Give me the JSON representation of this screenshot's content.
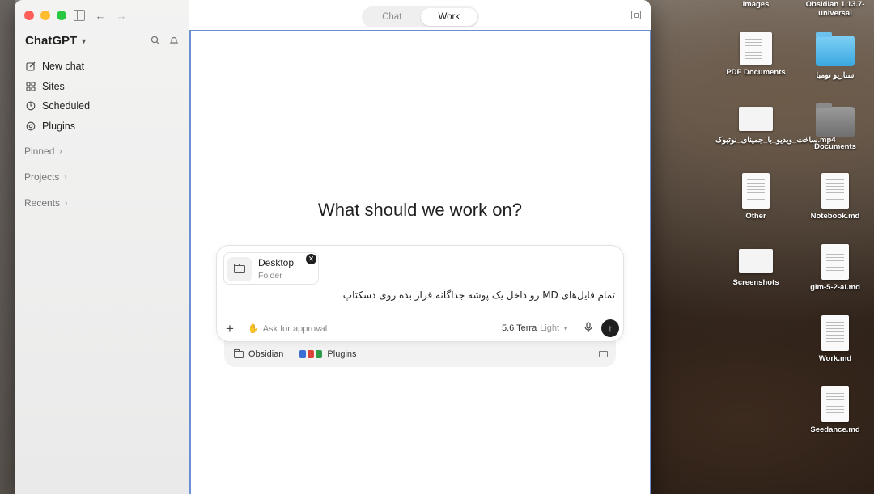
{
  "window": {
    "app_title": "ChatGPT",
    "nav": [
      {
        "label": "New chat",
        "icon": "compose-icon"
      },
      {
        "label": "Sites",
        "icon": "sites-icon"
      },
      {
        "label": "Scheduled",
        "icon": "clock-icon"
      },
      {
        "label": "Plugins",
        "icon": "plugin-icon"
      }
    ],
    "sections": [
      {
        "label": "Pinned"
      },
      {
        "label": "Projects"
      },
      {
        "label": "Recents"
      }
    ]
  },
  "main": {
    "tabs": [
      {
        "label": "Chat",
        "active": false
      },
      {
        "label": "Work",
        "active": true
      }
    ],
    "heading": "What should we work on?",
    "attachment": {
      "name": "Desktop",
      "type": "Folder"
    },
    "prompt": "تمام فایل‌های MD رو داخل یک پوشه جداگانه قرار بده روی دسکتاپ",
    "approval_label": "Ask for approval",
    "model_name": "5.6 Terra",
    "model_mode": "Light",
    "tray": {
      "folder_label": "Obsidian",
      "plugins_label": "Plugins"
    }
  },
  "desktop": {
    "items": [
      {
        "label": "Images"
      },
      {
        "label": "Obsidian 1.13.7-universal"
      },
      {
        "label": "PDF Documents"
      },
      {
        "label": "سناریو تومبا"
      },
      {
        "label": "ساخت_ویدیو_با_جمینای_نوتبوک.mp4"
      },
      {
        "label": "Documents"
      },
      {
        "label": "Other"
      },
      {
        "label": "Notebook.md"
      },
      {
        "label": "Screenshots"
      },
      {
        "label": "glm-5-2-ai.md"
      },
      {
        "label": "Work.md"
      },
      {
        "label": "Seedance.md"
      }
    ]
  },
  "colors": {
    "accent_line": "#6d8fd1",
    "traffic_red": "#ff5f57",
    "traffic_yellow": "#febc2e",
    "traffic_green": "#28c840"
  }
}
